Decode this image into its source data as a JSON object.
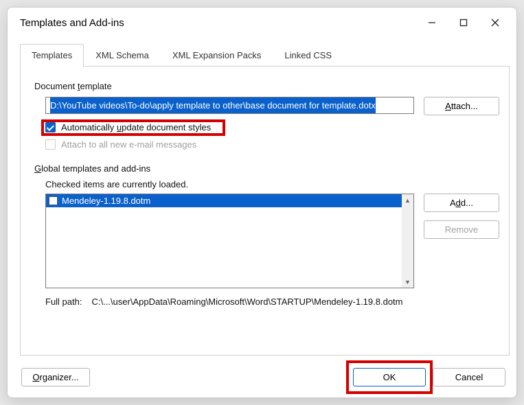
{
  "window": {
    "title": "Templates and Add-ins"
  },
  "tabs": {
    "templates": "Templates",
    "xml_schema": "XML Schema",
    "xml_exp": "XML Expansion Packs",
    "linked_css": "Linked CSS"
  },
  "doc_template": {
    "label_pre": "Document ",
    "label_u": "t",
    "label_post": "emplate",
    "value": "D:\\YouTube videos\\To-do\\apply template to other\\base document for template.dotx",
    "attach_pre": "",
    "attach_u": "A",
    "attach_post": "ttach..."
  },
  "checkboxes": {
    "auto_update_pre": "Automatically ",
    "auto_update_u": "u",
    "auto_update_post": "pdate document styles",
    "attach_mail": "Attach to all new e-mail messages"
  },
  "global": {
    "label_u": "G",
    "label_post": "lobal templates and add-ins",
    "checked_note": "Checked items are currently loaded.",
    "items": [
      {
        "label": "Mendeley-1.19.8.dotm",
        "checked": false
      }
    ],
    "add_pre": "A",
    "add_u": "d",
    "add_post": "d...",
    "remove": "Remove"
  },
  "fullpath": {
    "label": "Full path:",
    "value": "C:\\...\\user\\AppData\\Roaming\\Microsoft\\Word\\STARTUP\\Mendeley-1.19.8.dotm"
  },
  "buttons": {
    "organizer_u": "O",
    "organizer_post": "rganizer...",
    "ok": "OK",
    "cancel": "Cancel"
  }
}
